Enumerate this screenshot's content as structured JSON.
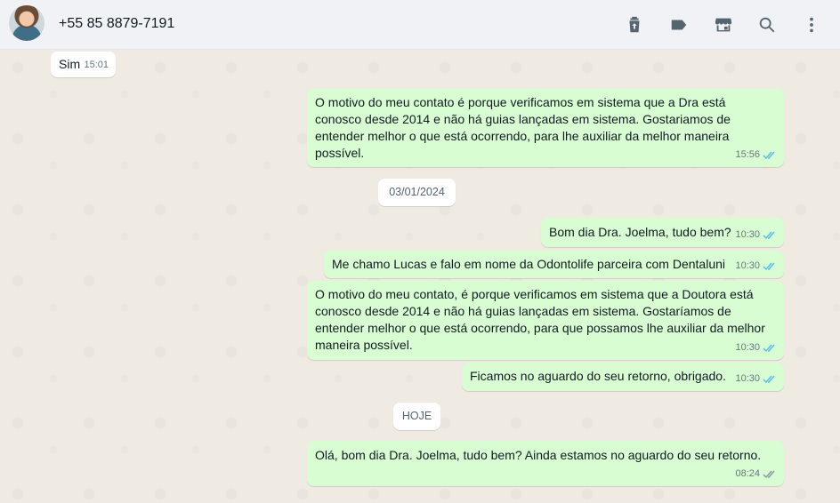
{
  "header": {
    "contact_name": "+55 85 8879-7191",
    "icons": [
      "delete-icon",
      "label-icon",
      "store-icon",
      "search-icon",
      "menu-icon"
    ]
  },
  "colors": {
    "header_bg": "#f0f2f5",
    "chat_bg": "#efeae2",
    "incoming_bubble": "#ffffff",
    "outgoing_bubble": "#d9fdd3",
    "read_tick": "#53bdeb"
  },
  "messages": [
    {
      "direction": "in",
      "text": "Sim",
      "time": "15:01"
    },
    {
      "direction": "out",
      "text": "O motivo do meu contato é porque verificamos em sistema que a Dra está conosco desde 2014 e não há guias lançadas em sistema. Gostariamos de entender melhor o que está ocorrendo, para lhe auxiliar da melhor maneira possível.",
      "time": "15:56",
      "status": "read"
    },
    {
      "direction": "out",
      "text": "Bom dia Dra. Joelma, tudo bem?",
      "time": "10:30",
      "status": "read"
    },
    {
      "direction": "out",
      "text": "Me chamo Lucas e falo em nome da Odontolife parceira com Dentaluni",
      "time": "10:30",
      "status": "read"
    },
    {
      "direction": "out",
      "text": "O motivo do meu contato, é porque verificamos em sistema que a Doutora está conosco desde 2014 e não há guias lançadas em sistema. Gostaríamos de entender melhor o que está ocorrendo, para que possamos lhe auxiliar da melhor maneira possível.",
      "time": "10:30",
      "status": "read"
    },
    {
      "direction": "out",
      "text": "Ficamos no aguardo do seu retorno, obrigado.",
      "time": "10:30",
      "status": "read"
    },
    {
      "direction": "out",
      "text": "Olá, bom dia Dra. Joelma, tudo bem? Ainda estamos no aguardo do seu retorno.",
      "time": "08:24",
      "status": "sent"
    }
  ],
  "date_separators": [
    "03/01/2024",
    "HOJE"
  ]
}
